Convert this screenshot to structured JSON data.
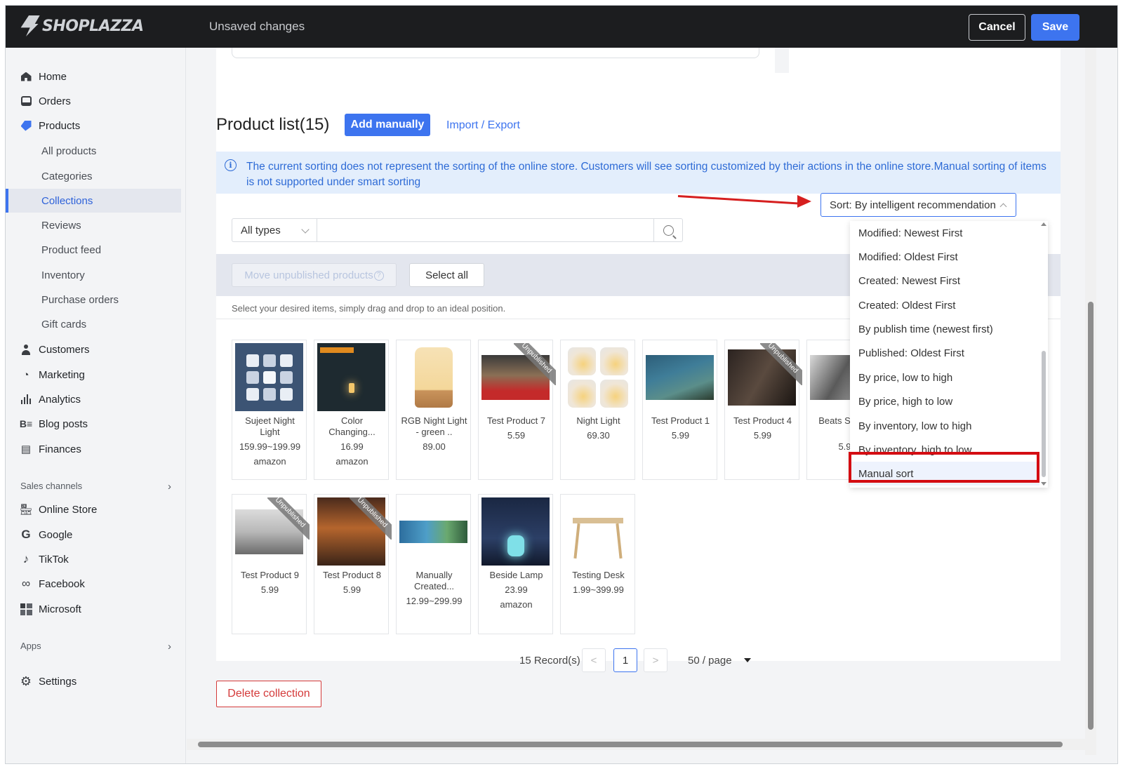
{
  "app": {
    "brand": "SHOPLAZZA",
    "status": "Unsaved changes",
    "cancel_label": "Cancel",
    "save_label": "Save"
  },
  "sidebar": {
    "items": [
      {
        "label": "Home",
        "icon": "home-icon"
      },
      {
        "label": "Orders",
        "icon": "orders-icon"
      },
      {
        "label": "Products",
        "icon": "tag-icon"
      }
    ],
    "products_sub": [
      "All products",
      "Categories",
      "Collections",
      "Reviews",
      "Product feed",
      "Inventory",
      "Purchase orders",
      "Gift cards"
    ],
    "items2": [
      {
        "label": "Customers",
        "icon": "person-icon"
      },
      {
        "label": "Marketing",
        "icon": "marketing-icon"
      },
      {
        "label": "Analytics",
        "icon": "analytics-icon"
      },
      {
        "label": "Blog posts",
        "icon": "blog-icon"
      },
      {
        "label": "Finances",
        "icon": "finances-icon"
      }
    ],
    "sales_channels_label": "Sales channels",
    "channels": [
      {
        "label": "Online Store",
        "icon": "store-icon"
      },
      {
        "label": "Google",
        "icon": "google-icon"
      },
      {
        "label": "TikTok",
        "icon": "tiktok-icon"
      },
      {
        "label": "Facebook",
        "icon": "meta-icon"
      },
      {
        "label": "Microsoft",
        "icon": "microsoft-icon"
      }
    ],
    "apps_label": "Apps",
    "settings_label": "Settings",
    "active_item": "Collections"
  },
  "product_list": {
    "title": "Product list(15)",
    "add_label": "Add manually",
    "import_export_label": "Import / Export",
    "info_text": "The current sorting does not represent the sorting of the online store. Customers will see sorting customized by their actions in the online store.Manual sorting of items is not supported under smart sorting",
    "type_filter": "All types",
    "search_placeholder": "",
    "sort_value": "Sort: By intelligent recommendation",
    "move_unpublished_label": "Move unpublished products",
    "select_all_label": "Select all",
    "drag_hint": "Select your desired items, simply drag and drop to an ideal position.",
    "unpublished_label": "Unpublished"
  },
  "products": [
    {
      "name": "Sujeet Night Light",
      "price": "159.99~199.99",
      "vendor": "amazon",
      "unpublished": false
    },
    {
      "name": "Color Changing...",
      "price": "16.99",
      "vendor": "amazon",
      "unpublished": false
    },
    {
      "name": "RGB Night Light - green ..",
      "price": "89.00",
      "vendor": "",
      "unpublished": false
    },
    {
      "name": "Test Product 7",
      "price": "5.59",
      "vendor": "",
      "unpublished": true
    },
    {
      "name": "Night Light",
      "price": "69.30",
      "vendor": "",
      "unpublished": false
    },
    {
      "name": "Test Product 1",
      "price": "5.99",
      "vendor": "",
      "unpublished": false
    },
    {
      "name": "Test Product 4",
      "price": "5.99",
      "vendor": "",
      "unpublished": true
    },
    {
      "name": "Beats St 10e",
      "price": "5.9",
      "vendor": "",
      "unpublished": false
    },
    {
      "name": "Test Product 9",
      "price": "5.99",
      "vendor": "",
      "unpublished": true
    },
    {
      "name": "Test Product 8",
      "price": "5.99",
      "vendor": "",
      "unpublished": true
    },
    {
      "name": "Manually Created...",
      "price": "12.99~299.99",
      "vendor": "",
      "unpublished": false
    },
    {
      "name": "Beside Lamp",
      "price": "23.99",
      "vendor": "amazon",
      "unpublished": false
    },
    {
      "name": "Testing Desk",
      "price": "1.99~399.99",
      "vendor": "",
      "unpublished": false
    }
  ],
  "sort_options": [
    "Modified: Newest First",
    "Modified: Oldest First",
    "Created: Newest First",
    "Created: Oldest First",
    "By publish time (newest first)",
    "Published: Oldest First",
    "By price, low to high",
    "By price, high to low",
    "By inventory, low to high",
    "By inventory, high to low",
    "Manual sort"
  ],
  "pagination": {
    "records": "15 Record(s)",
    "current_page": "1",
    "prev": "<",
    "next": ">",
    "page_size": "50 / page"
  },
  "delete_label": "Delete collection",
  "colors": {
    "accent": "#3d74ef",
    "danger": "#d43a3a",
    "annotation": "#d40d12"
  }
}
